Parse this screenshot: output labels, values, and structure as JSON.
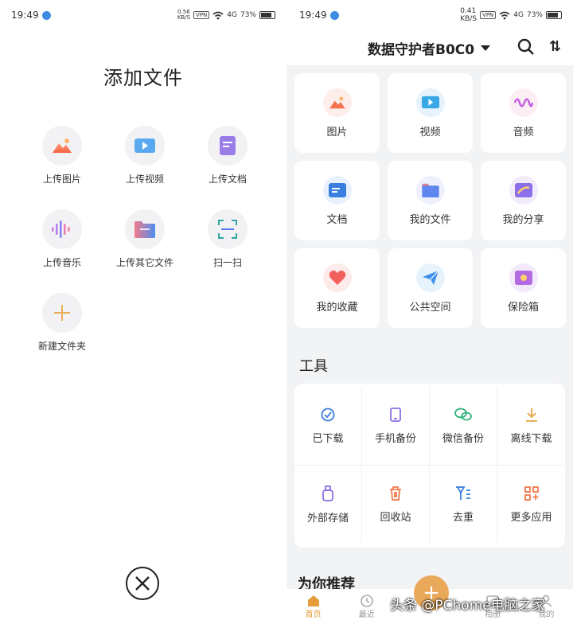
{
  "left": {
    "status": {
      "time": "19:49",
      "speed": "0.56",
      "speed_unit": "KB/S",
      "vpn": "VPN",
      "signal": "4G",
      "battery": "73%"
    },
    "title": "添加文件",
    "items": [
      {
        "label": "上传图片",
        "icon": "image-icon"
      },
      {
        "label": "上传视频",
        "icon": "video-icon"
      },
      {
        "label": "上传文档",
        "icon": "document-icon"
      },
      {
        "label": "上传音乐",
        "icon": "music-icon"
      },
      {
        "label": "上传其它文件",
        "icon": "folder-icon"
      },
      {
        "label": "扫一扫",
        "icon": "scan-icon"
      },
      {
        "label": "新建文件夹",
        "icon": "plus-icon"
      }
    ]
  },
  "right": {
    "status": {
      "time": "19:49",
      "speed": "0.41",
      "speed_unit": "KB/S",
      "vpn": "VPN",
      "signal": "4G",
      "battery": "73%"
    },
    "account": "数据守护者B0C0",
    "sort_symbol": "⇅",
    "cards": [
      {
        "label": "图片",
        "icon": "image-icon"
      },
      {
        "label": "视频",
        "icon": "video-icon"
      },
      {
        "label": "音频",
        "icon": "audio-icon"
      },
      {
        "label": "文档",
        "icon": "document-icon"
      },
      {
        "label": "我的文件",
        "icon": "folder-icon"
      },
      {
        "label": "我的分享",
        "icon": "share-icon"
      },
      {
        "label": "我的收藏",
        "icon": "heart-icon"
      },
      {
        "label": "公共空间",
        "icon": "paper-plane-icon"
      },
      {
        "label": "保险箱",
        "icon": "safe-icon"
      }
    ],
    "tools_title": "工具",
    "tools": [
      {
        "label": "已下载",
        "icon": "download-check-icon"
      },
      {
        "label": "手机备份",
        "icon": "phone-icon"
      },
      {
        "label": "微信备份",
        "icon": "wechat-icon"
      },
      {
        "label": "离线下载",
        "icon": "download-icon"
      },
      {
        "label": "外部存储",
        "icon": "usb-icon"
      },
      {
        "label": "回收站",
        "icon": "trash-icon"
      },
      {
        "label": "去重",
        "icon": "dedup-icon"
      },
      {
        "label": "更多应用",
        "icon": "apps-icon"
      }
    ],
    "recommend_title": "为你推荐",
    "bottom_nav": [
      {
        "label": "首页",
        "icon": "home-icon"
      },
      {
        "label": "最近",
        "icon": "clock-icon"
      },
      {
        "label": "",
        "icon": "fab-plus-icon"
      },
      {
        "label": "相册",
        "icon": "album-icon"
      },
      {
        "label": "我的",
        "icon": "user-icon"
      }
    ],
    "fab_symbol": "+",
    "watermark": "头条 @PChome电脑之家"
  }
}
